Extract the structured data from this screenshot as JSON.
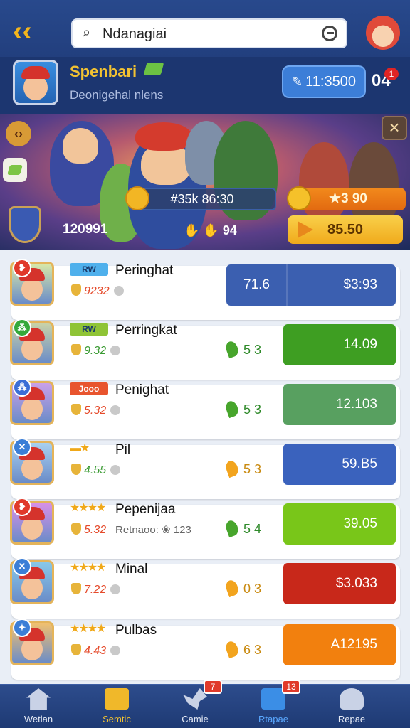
{
  "header": {
    "search_value": "Ndanagiai",
    "back_icon": "back-arrow-icon",
    "search_icon": "search-icon",
    "clear_icon": "clear-icon"
  },
  "profile": {
    "name": "Spenbari",
    "subtitle": "Deonigehal nlens",
    "coins": "11:3500",
    "notifications": "04",
    "notification_badge": "1"
  },
  "banner": {
    "left_badge": "‹›",
    "stat_text": "#35k 86:30",
    "orange_button": "★3 90",
    "yellow_button": "85.50",
    "left_number": "120991",
    "mid_number": "✋ ✋ 94",
    "close": "×"
  },
  "list": [
    {
      "tag": "RW",
      "tag_color": "#4fb0ec",
      "stars": "",
      "name": "Peringhat",
      "stat_num": "9232",
      "stat_green": false,
      "extra": "",
      "mid_pin": "",
      "mid": "",
      "btn_left": "71.6",
      "btn_right": "$3:93",
      "btn_color": "#3b5fb0",
      "split": true,
      "badge_color": "#e0392a",
      "badge": "❥",
      "avatar_color": "#d8e8a8"
    },
    {
      "tag": "RW",
      "tag_color": "#8fc436",
      "stars": "",
      "name": "Perringkat",
      "stat_num": "9.32",
      "stat_green": true,
      "extra": "",
      "mid_pin": "#47a52c",
      "mid": "5 3",
      "btn_left": "",
      "btn_right": "14.09",
      "btn_color": "#3e9e22",
      "split": false,
      "badge_color": "#34a83a",
      "badge": "⁂",
      "avatar_color": "#c8d2a8"
    },
    {
      "tag": "Jooo",
      "tag_color": "#e8542e",
      "stars": "",
      "name": "Penighat",
      "stat_num": "5.32",
      "stat_green": false,
      "extra": "",
      "mid_pin": "#47a52c",
      "mid": "5 3",
      "btn_left": "",
      "btn_right": "12.103",
      "btn_color": "#58a060",
      "split": false,
      "badge_color": "#3b6ed6",
      "badge": "⁂",
      "avatar_color": "#c9a0e8"
    },
    {
      "tag": "",
      "tag_color": "",
      "stars": "▬★",
      "name": "Pil",
      "stat_num": "4.55",
      "stat_green": true,
      "extra": "",
      "mid_pin": "#f2a41e",
      "mid": "5 3",
      "btn_left": "",
      "btn_right": "59.B5",
      "btn_color": "#3a62bd",
      "split": false,
      "badge_color": "#3b7ed6",
      "badge": "✕",
      "avatar_color": "#a8d0f0"
    },
    {
      "tag": "",
      "tag_color": "",
      "stars": "★★★★",
      "name": "Pepenijaa",
      "stat_num": "5.32",
      "stat_green": false,
      "extra": "Retnaoo: ❀ 123",
      "mid_pin": "#47a52c",
      "mid": "5 4",
      "btn_left": "",
      "btn_right": "39.05",
      "btn_color": "#79c619",
      "split": false,
      "badge_color": "#e0392a",
      "badge": "❥",
      "avatar_color": "#d890e8"
    },
    {
      "tag": "",
      "tag_color": "",
      "stars": "★★★★",
      "name": "Minal",
      "stat_num": "7.22",
      "stat_green": false,
      "extra": "",
      "mid_pin": "#f2a41e",
      "mid": "0 3",
      "btn_left": "",
      "btn_right": "$3.033",
      "btn_color": "#c8281a",
      "split": false,
      "badge_color": "#3b7ed6",
      "badge": "✕",
      "avatar_color": "#88c8e8"
    },
    {
      "tag": "",
      "tag_color": "",
      "stars": "★★★★",
      "name": "Pulbas",
      "stat_num": "4.43",
      "stat_green": false,
      "extra": "",
      "mid_pin": "#f2a41e",
      "mid": "6 3",
      "btn_left": "",
      "btn_right": "A12195",
      "btn_color": "#f2800e",
      "split": false,
      "badge_color": "#3b7ed6",
      "badge": "✦",
      "avatar_color": "#f0c070"
    }
  ],
  "nav": [
    {
      "label": "Wetlan",
      "icon": "home-icon",
      "badge": ""
    },
    {
      "label": "Semtic",
      "icon": "box-icon",
      "badge": ""
    },
    {
      "label": "Camie",
      "icon": "bird-icon",
      "badge": "7"
    },
    {
      "label": "Rtapae",
      "icon": "shop-icon",
      "badge": "13"
    },
    {
      "label": "Repae",
      "icon": "people-icon",
      "badge": ""
    }
  ]
}
